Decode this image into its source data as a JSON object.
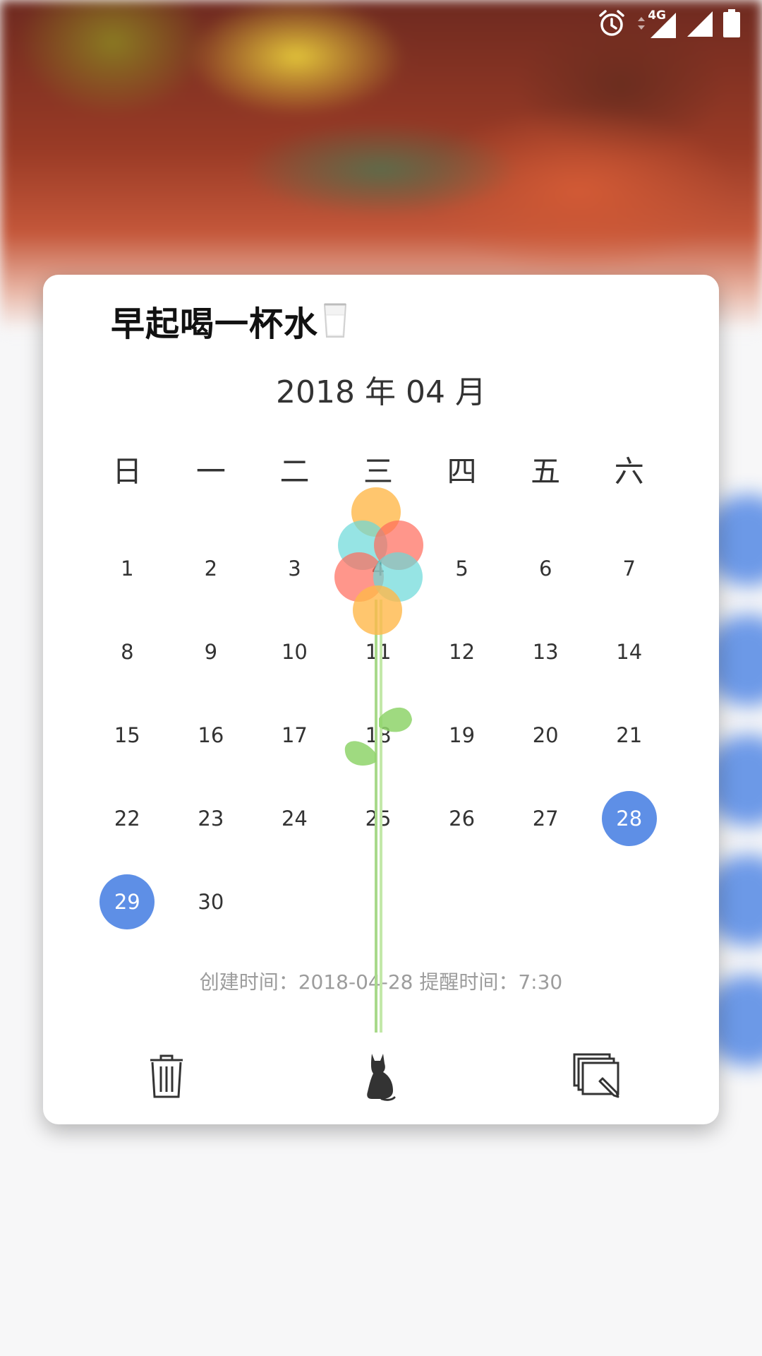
{
  "status_bar": {
    "network": "4G",
    "icons": [
      "alarm-icon",
      "data-arrows-icon",
      "signal-icon",
      "signal-icon-2",
      "battery-icon"
    ]
  },
  "habit": {
    "title": "早起喝一杯水",
    "emoji_icon": "milk-glass-icon"
  },
  "calendar": {
    "month_label": "2018 年 04 月",
    "weekdays": [
      "日",
      "一",
      "二",
      "三",
      "四",
      "五",
      "六"
    ],
    "weeks": [
      [
        "1",
        "2",
        "3",
        "4",
        "5",
        "6",
        "7"
      ],
      [
        "8",
        "9",
        "10",
        "11",
        "12",
        "13",
        "14"
      ],
      [
        "15",
        "16",
        "17",
        "18",
        "19",
        "20",
        "21"
      ],
      [
        "22",
        "23",
        "24",
        "25",
        "26",
        "27",
        "28"
      ],
      [
        "29",
        "30",
        "",
        "",
        "",
        "",
        ""
      ]
    ],
    "checked_days": [
      "28",
      "29"
    ],
    "accent_color": "#5e8fe6"
  },
  "footer": {
    "info": "创建时间：2018-04-28  提醒时间：7:30"
  },
  "actions": {
    "delete_icon": "trash-icon",
    "center_icon": "cat-icon",
    "edit_icon": "edit-cards-icon"
  }
}
